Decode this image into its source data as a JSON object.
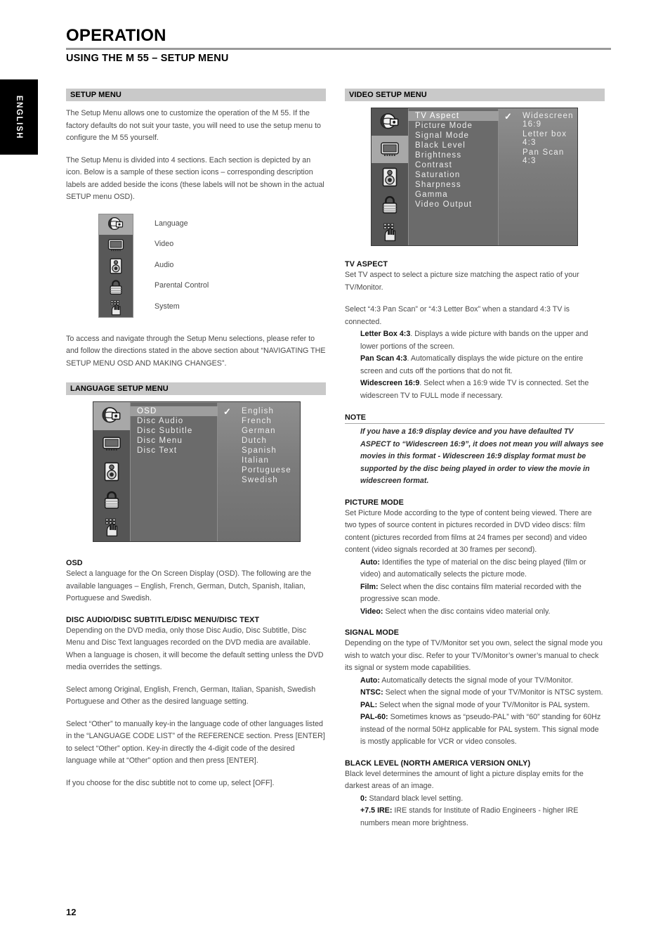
{
  "sidebar_tab": {
    "label": "ENGLISH"
  },
  "header": {
    "chapter_title": "OPERATION",
    "section_title": "USING THE M 55 – SETUP MENU"
  },
  "page_number": "12",
  "left_column": {
    "setup_menu": {
      "bar_label": "SETUP MENU",
      "paragraphs": [
        "The Setup Menu allows one to customize the operation of the M 55. If the factory defaults do not suit your taste, you will need to use the setup menu to configure the M 55 yourself.",
        "The Setup Menu is divided into 4 sections.  Each section is depicted by an icon.  Below is a sample of these section icons – corresponding description labels are added beside the icons (these labels will not be shown in the actual SETUP menu OSD).",
        "To access and navigate through the Setup Menu selections, please refer to and follow the directions stated in the above section about “NAVIGATING THE SETUP MENU OSD AND MAKING CHANGES”."
      ],
      "legend": [
        {
          "icon": "globe-language-icon",
          "label": "Language",
          "selected": true
        },
        {
          "icon": "tv-monitor-video-icon",
          "label": "Video",
          "selected": false
        },
        {
          "icon": "speaker-audio-icon",
          "label": "Audio",
          "selected": false
        },
        {
          "icon": "padlock-parental-control-icon",
          "label": "Parental Control",
          "selected": false
        },
        {
          "icon": "hand-keypad-system-icon",
          "label": "System",
          "selected": false
        }
      ]
    },
    "language_setup_menu": {
      "bar_label": "LANGUAGE SETUP MENU",
      "osd": {
        "rail_icons": [
          {
            "icon": "globe-language-icon",
            "selected": true
          },
          {
            "icon": "tv-monitor-video-icon",
            "selected": false
          },
          {
            "icon": "speaker-audio-icon",
            "selected": false
          },
          {
            "icon": "padlock-parental-control-icon",
            "selected": false
          },
          {
            "icon": "hand-keypad-system-icon",
            "selected": false
          }
        ],
        "menu_items": [
          {
            "label": "OSD",
            "selected": true
          },
          {
            "label": "Disc Audio",
            "selected": false
          },
          {
            "label": "Disc Subtitle",
            "selected": false
          },
          {
            "label": "Disc Menu",
            "selected": false
          },
          {
            "label": "Disc Text",
            "selected": false
          }
        ],
        "options": [
          {
            "label": "English",
            "checked": true
          },
          {
            "label": "French",
            "checked": false
          },
          {
            "label": "German",
            "checked": false
          },
          {
            "label": "Dutch",
            "checked": false
          },
          {
            "label": "Spanish",
            "checked": false
          },
          {
            "label": "Italian",
            "checked": false
          },
          {
            "label": "Portuguese",
            "checked": false
          },
          {
            "label": "Swedish",
            "checked": false
          }
        ]
      },
      "osd_section": {
        "heading": "OSD",
        "body": "Select a language for the On Screen Display (OSD). The following are the available languages – English, French, German, Dutch, Spanish, Italian, Portuguese and Swedish."
      },
      "disc_section": {
        "heading": "DISC AUDIO/DISC SUBTITLE/DISC MENU/DISC TEXT",
        "paragraphs": [
          "Depending on the DVD media, only those Disc Audio, Disc Subtitle, Disc Menu and Disc Text languages recorded on the DVD media are available. When a language is chosen, it will become the default setting unless the DVD media overrides the settings.",
          "Select among Original, English, French, German, Italian, Spanish, Swedish Portuguese and Other as the desired language setting.",
          "Select “Other” to manually key-in the language code of other languages listed in the “LANGUAGE CODE LIST” of the REFERENCE section.  Press [ENTER] to select “Other” option. Key-in directly the 4-digit code of the desired language while at “Other” option and then press [ENTER].",
          "If you choose for the disc subtitle not to come up, select [OFF]."
        ]
      }
    }
  },
  "right_column": {
    "video_setup_menu": {
      "bar_label": "VIDEO SETUP MENU",
      "osd": {
        "rail_icons": [
          {
            "icon": "globe-language-icon",
            "selected": false
          },
          {
            "icon": "tv-monitor-video-icon",
            "selected": true
          },
          {
            "icon": "speaker-audio-icon",
            "selected": false
          },
          {
            "icon": "padlock-parental-control-icon",
            "selected": false
          },
          {
            "icon": "hand-keypad-system-icon",
            "selected": false
          }
        ],
        "menu_items": [
          {
            "label": "TV Aspect",
            "selected": true
          },
          {
            "label": "Picture Mode",
            "selected": false
          },
          {
            "label": "Signal Mode",
            "selected": false
          },
          {
            "label": "Black Level",
            "selected": false
          },
          {
            "label": "Brightness",
            "selected": false
          },
          {
            "label": "Contrast",
            "selected": false
          },
          {
            "label": "Saturation",
            "selected": false
          },
          {
            "label": "Sharpness",
            "selected": false
          },
          {
            "label": "Gamma",
            "selected": false
          },
          {
            "label": "Video Output",
            "selected": false
          }
        ],
        "options": [
          {
            "label": "Widescreen 16:9",
            "checked": true
          },
          {
            "label": "Letter box 4:3",
            "checked": false
          },
          {
            "label": "Pan Scan 4:3",
            "checked": false
          }
        ]
      },
      "tv_aspect": {
        "heading": "TV ASPECT",
        "intro": "Set TV aspect to select a picture size matching the aspect ratio of your TV/Monitor.",
        "lead": "Select “4:3 Pan Scan” or “4:3 Letter Box” when a standard 4:3 TV is connected.",
        "items": [
          {
            "term": "Letter Box 4:3",
            "desc": ". Displays a wide picture with bands on the upper and lower portions of the screen."
          },
          {
            "term": "Pan Scan 4:3",
            "desc": ".  Automatically displays the wide picture on the entire screen and cuts off the portions that do not fit."
          },
          {
            "term": "Widescreen 16:9",
            "desc": ". Select when a 16:9 wide TV is connected. Set the widescreen TV to FULL mode if necessary."
          }
        ]
      },
      "note": {
        "heading": "NOTE",
        "body": "If you have a 16:9 display device and you have defaulted TV ASPECT to “Widescreen 16:9”, it does not mean you will always see movies in this format - Widescreen 16:9 display format must be supported by the disc being played in order to view the movie in widescreen format."
      },
      "picture_mode": {
        "heading": "PICTURE MODE",
        "intro": "Set Picture Mode according to the type of content being viewed. There are two types of source content in pictures recorded in DVD video discs: film content (pictures recorded from films at 24 frames per second) and video content (video signals recorded at 30 frames per second).",
        "items": [
          {
            "term": "Auto:",
            "desc": "  Identifies the type of material on the disc being played (film or video) and automatically selects the picture mode."
          },
          {
            "term": "Film:",
            "desc": "  Select when the disc contains film material recorded with the progressive scan mode."
          },
          {
            "term": "Video:",
            "desc": "  Select when the disc contains video material only."
          }
        ]
      },
      "signal_mode": {
        "heading": "SIGNAL MODE",
        "intro": "Depending on the type of TV/Monitor set you own, select the signal mode you wish to watch your disc. Refer to your TV/Monitor’s owner’s manual to check its signal or system mode capabilities.",
        "items": [
          {
            "term": "Auto:",
            "desc": "  Automatically detects the signal mode of your TV/Monitor."
          },
          {
            "term": "NTSC:",
            "desc": "  Select when the signal mode of your TV/Monitor is NTSC system."
          },
          {
            "term": "PAL:",
            "desc": "  Select when the signal mode of your TV/Monitor is PAL system."
          },
          {
            "term": "PAL-60:",
            "desc": " Sometimes knows as “pseudo-PAL” with “60” standing for 60Hz instead of the normal 50Hz applicable for PAL system.  This signal mode is mostly applicable for VCR or video consoles."
          }
        ]
      },
      "black_level": {
        "heading": "BLACK LEVEL (NORTH AMERICA VERSION ONLY)",
        "intro": "Black level determines the amount of light a picture display emits for the darkest areas of an image.",
        "items": [
          {
            "term": "0:",
            "desc": "  Standard black level setting."
          },
          {
            "term": "+7.5 IRE:",
            "desc": "  IRE stands for Institute of Radio Engineers - higher IRE numbers mean more brightness."
          }
        ]
      }
    }
  },
  "colors": {
    "bar_gray": "#c9c9c9",
    "rule_gray": "#9b9b9b",
    "osd_rail": "#555555",
    "osd_selected": "#a8a8a8",
    "tab_black": "#000000"
  }
}
